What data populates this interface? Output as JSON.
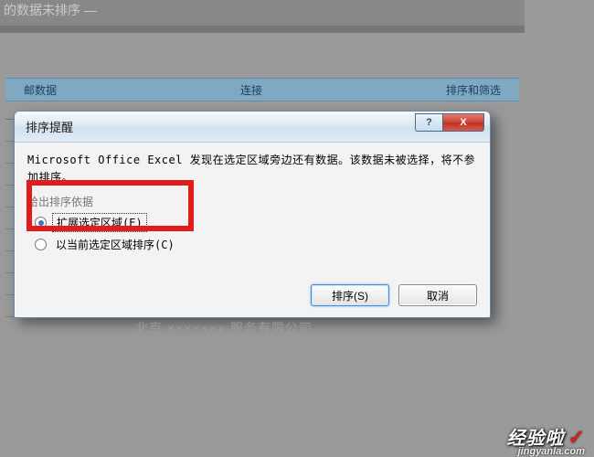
{
  "background": {
    "title_fragment": "的数据未排序 —",
    "ribbon": {
      "left": "邮数据",
      "center": "连接",
      "right": "排序和筛选"
    },
    "bottom_blurred": "北京 ××××××× 服务有限公司"
  },
  "dialog": {
    "title": "排序提醒",
    "message": "Microsoft Office Excel 发现在选定区域旁边还有数据。该数据未被选择，将不参加排序。",
    "group_label": "给出排序依据",
    "option1": "扩展选定区域(E)",
    "option2": "以当前选定区域排序(C)",
    "sort_button": "排序(S)",
    "cancel_button": "取消",
    "help_symbol": "?",
    "close_symbol": "X"
  },
  "watermark": {
    "brand": "经验啦",
    "check": "✓",
    "domain": "jingyanla.com"
  }
}
